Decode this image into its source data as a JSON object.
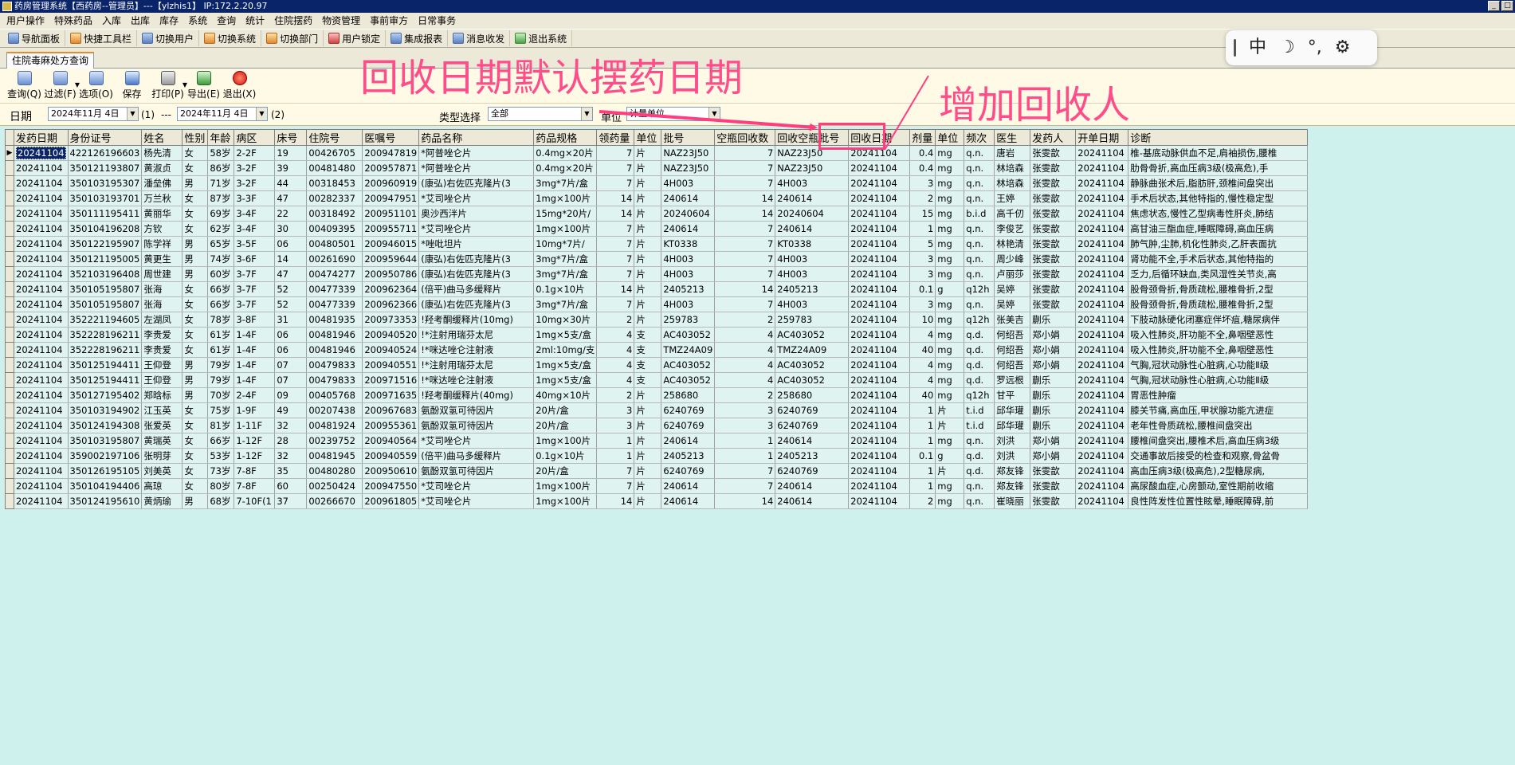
{
  "window": {
    "title": "药房管理系统【西药房--管理员】---【ylzhis1】 IP:172.2.20.97",
    "controls": [
      "_",
      "□"
    ]
  },
  "menus": [
    "用户操作",
    "特殊药品",
    "入库",
    "出库",
    "库存",
    "系统",
    "查询",
    "统计",
    "住院摆药",
    "物资管理",
    "事前审方",
    "日常事务"
  ],
  "quick_toolbar": [
    "导航面板",
    "快捷工具栏",
    "切换用户",
    "切换系统",
    "切换部门",
    "用户锁定",
    "集成报表",
    "消息收发",
    "退出系统"
  ],
  "tab": {
    "label": "住院毒麻处方查询"
  },
  "toolbar": {
    "buttons": [
      "查询(Q)",
      "过滤(F)",
      "选项(O)",
      "保存",
      "打印(P)",
      "导出(E)",
      "退出(X)"
    ]
  },
  "filter": {
    "date_label": "日期",
    "date_from": "2024年11月 4日",
    "date_to": "2024年11月 4日",
    "marker1": "(1)",
    "sep": "---",
    "marker2": "(2)",
    "type_label": "类型选择",
    "type_value": "全部",
    "unit_label": "单位",
    "unit_value": "计量单位"
  },
  "table": {
    "columns": [
      "发药日期",
      "身份证号",
      "姓名",
      "性别",
      "年龄",
      "病区",
      "床号",
      "住院号",
      "医嘱号",
      "药品名称",
      "药品规格",
      "领药量",
      "单位",
      "批号",
      "空瓶回收数",
      "回收空瓶批号",
      "回收日期",
      "剂量",
      "单位",
      "频次",
      "医生",
      "发药人",
      "开单日期",
      "诊断"
    ],
    "rows": [
      [
        "20241104",
        "422126196603",
        "杨先清",
        "女",
        "58岁",
        "2-2F",
        "19",
        "00426705",
        "200947819",
        "*阿普唑仑片",
        "0.4mg×20片",
        "7",
        "片",
        "NAZ23J50",
        "7",
        "NAZ23J50",
        "20241104",
        "0.4",
        "mg",
        "q.n.",
        "唐岩",
        "张雯歆",
        "20241104",
        "椎-基底动脉供血不足,肩袖损伤,腰椎"
      ],
      [
        "20241104",
        "350121193807",
        "黄淑贞",
        "女",
        "86岁",
        "3-2F",
        "39",
        "00481480",
        "200957871",
        "*阿普唑仑片",
        "0.4mg×20片",
        "7",
        "片",
        "NAZ23J50",
        "7",
        "NAZ23J50",
        "20241104",
        "0.4",
        "mg",
        "q.n.",
        "林培森",
        "张雯歆",
        "20241104",
        "肋骨骨折,高血压病3级(极高危),手"
      ],
      [
        "20241104",
        "350103195307",
        "潘垒佛",
        "男",
        "71岁",
        "3-2F",
        "44",
        "00318453",
        "200960919",
        "(康弘)右佐匹克隆片(3",
        "3mg*7片/盒",
        "7",
        "片",
        "4H003",
        "7",
        "4H003",
        "20241104",
        "3",
        "mg",
        "q.n.",
        "林培森",
        "张雯歆",
        "20241104",
        "静脉曲张术后,脂肪肝,颈椎间盘突出"
      ],
      [
        "20241104",
        "350103193701",
        "万兰秋",
        "女",
        "87岁",
        "3-3F",
        "47",
        "00282337",
        "200947951",
        "*艾司唑仑片",
        "1mg×100片",
        "14",
        "片",
        "240614",
        "14",
        "240614",
        "20241104",
        "2",
        "mg",
        "q.n.",
        "王婷",
        "张雯歆",
        "20241104",
        "手术后状态,其他特指的,慢性稳定型"
      ],
      [
        "20241104",
        "350111195411",
        "黄丽华",
        "女",
        "69岁",
        "3-4F",
        "22",
        "00318492",
        "200951101",
        "奥沙西泮片",
        "15mg*20片/",
        "14",
        "片",
        "20240604",
        "14",
        "20240604",
        "20241104",
        "15",
        "mg",
        "b.i.d",
        "高千仞",
        "张雯歆",
        "20241104",
        "焦虑状态,慢性乙型病毒性肝炎,肺结"
      ],
      [
        "20241104",
        "350104196208",
        "方钦",
        "女",
        "62岁",
        "3-4F",
        "30",
        "00409395",
        "200955711",
        "*艾司唑仑片",
        "1mg×100片",
        "7",
        "片",
        "240614",
        "7",
        "240614",
        "20241104",
        "1",
        "mg",
        "q.n.",
        "李俊艺",
        "张雯歆",
        "20241104",
        "高甘油三酯血症,睡眠障碍,高血压病"
      ],
      [
        "20241104",
        "350122195907",
        "陈学祥",
        "男",
        "65岁",
        "3-5F",
        "06",
        "00480501",
        "200946015",
        "*唑吡坦片",
        "10mg*7片/",
        "7",
        "片",
        "KT0338",
        "7",
        "KT0338",
        "20241104",
        "5",
        "mg",
        "q.n.",
        "林艳清",
        "张雯歆",
        "20241104",
        "肺气肿,尘肺,机化性肺炎,乙肝表面抗"
      ],
      [
        "20241104",
        "350121195005",
        "黄更生",
        "男",
        "74岁",
        "3-6F",
        "14",
        "00261690",
        "200959644",
        "(康弘)右佐匹克隆片(3",
        "3mg*7片/盒",
        "7",
        "片",
        "4H003",
        "7",
        "4H003",
        "20241104",
        "3",
        "mg",
        "q.n.",
        "周少峰",
        "张雯歆",
        "20241104",
        "肾功能不全,手术后状态,其他特指的"
      ],
      [
        "20241104",
        "352103196408",
        "周世建",
        "男",
        "60岁",
        "3-7F",
        "47",
        "00474277",
        "200950786",
        "(康弘)右佐匹克隆片(3",
        "3mg*7片/盒",
        "7",
        "片",
        "4H003",
        "7",
        "4H003",
        "20241104",
        "3",
        "mg",
        "q.n.",
        "卢丽莎",
        "张雯歆",
        "20241104",
        "乏力,后循环缺血,类风湿性关节炎,高"
      ],
      [
        "20241104",
        "350105195807",
        "张海",
        "女",
        "66岁",
        "3-7F",
        "52",
        "00477339",
        "200962364",
        "(倍平)曲马多缓释片",
        "0.1g×10片",
        "14",
        "片",
        "2405213",
        "14",
        "2405213",
        "20241104",
        "0.1",
        "g",
        "q12h",
        "吴婷",
        "张雯歆",
        "20241104",
        "股骨颈骨折,骨质疏松,腰椎骨折,2型"
      ],
      [
        "20241104",
        "350105195807",
        "张海",
        "女",
        "66岁",
        "3-7F",
        "52",
        "00477339",
        "200962366",
        "(康弘)右佐匹克隆片(3",
        "3mg*7片/盒",
        "7",
        "片",
        "4H003",
        "7",
        "4H003",
        "20241104",
        "3",
        "mg",
        "q.n.",
        "吴婷",
        "张雯歆",
        "20241104",
        "股骨颈骨折,骨质疏松,腰椎骨折,2型"
      ],
      [
        "20241104",
        "352221194605",
        "左湖凤",
        "女",
        "78岁",
        "3-8F",
        "31",
        "00481935",
        "200973353",
        "!羟考酮缓释片(10mg)",
        "10mg×30片",
        "2",
        "片",
        "259783",
        "2",
        "259783",
        "20241104",
        "10",
        "mg",
        "q12h",
        "张美吉",
        "蒯乐",
        "20241104",
        "下肢动脉硬化闭塞症伴坏疽,糖尿病伴"
      ],
      [
        "20241104",
        "352228196211",
        "李贵爱",
        "女",
        "61岁",
        "1-4F",
        "06",
        "00481946",
        "200940520",
        "!*注射用瑞芬太尼",
        "1mg×5支/盒",
        "4",
        "支",
        "AC403052",
        "4",
        "AC403052",
        "20241104",
        "4",
        "mg",
        "q.d.",
        "何绍吾",
        "郑小娟",
        "20241104",
        "吸入性肺炎,肝功能不全,鼻咽壁恶性"
      ],
      [
        "20241104",
        "352228196211",
        "李贵爱",
        "女",
        "61岁",
        "1-4F",
        "06",
        "00481946",
        "200940524",
        "!*咪达唑仑注射液",
        "2ml:10mg/支",
        "4",
        "支",
        "TMZ24A09",
        "4",
        "TMZ24A09",
        "20241104",
        "40",
        "mg",
        "q.d.",
        "何绍吾",
        "郑小娟",
        "20241104",
        "吸入性肺炎,肝功能不全,鼻咽壁恶性"
      ],
      [
        "20241104",
        "350125194411",
        "王仰登",
        "男",
        "79岁",
        "1-4F",
        "07",
        "00479833",
        "200940551",
        "!*注射用瑞芬太尼",
        "1mg×5支/盒",
        "4",
        "支",
        "AC403052",
        "4",
        "AC403052",
        "20241104",
        "4",
        "mg",
        "q.d.",
        "何绍吾",
        "郑小娟",
        "20241104",
        "气胸,冠状动脉性心脏病,心功能Ⅱ级"
      ],
      [
        "20241104",
        "350125194411",
        "王仰登",
        "男",
        "79岁",
        "1-4F",
        "07",
        "00479833",
        "200971516",
        "!*咪达唑仑注射液",
        "1mg×5支/盒",
        "4",
        "支",
        "AC403052",
        "4",
        "AC403052",
        "20241104",
        "4",
        "mg",
        "q.d.",
        "罗远根",
        "蒯乐",
        "20241104",
        "气胸,冠状动脉性心脏病,心功能Ⅱ级"
      ],
      [
        "20241104",
        "350127195402",
        "郑晗标",
        "男",
        "70岁",
        "2-4F",
        "09",
        "00405768",
        "200971635",
        "!羟考酮缓释片(40mg)",
        "40mg×10片",
        "2",
        "片",
        "258680",
        "2",
        "258680",
        "20241104",
        "40",
        "mg",
        "q12h",
        "甘平",
        "蒯乐",
        "20241104",
        "胃恶性肿瘤"
      ],
      [
        "20241104",
        "350103194902",
        "江玉英",
        "女",
        "75岁",
        "1-9F",
        "49",
        "00207438",
        "200967683",
        "氨酚双氢可待因片",
        "20片/盒",
        "3",
        "片",
        "6240769",
        "3",
        "6240769",
        "20241104",
        "1",
        "片",
        "t.i.d",
        "邱华瓘",
        "蒯乐",
        "20241104",
        "膝关节痛,高血压,甲状腺功能亢进症"
      ],
      [
        "20241104",
        "350124194308",
        "张爱英",
        "女",
        "81岁",
        "1-11F",
        "32",
        "00481924",
        "200955361",
        "氨酚双氢可待因片",
        "20片/盒",
        "3",
        "片",
        "6240769",
        "3",
        "6240769",
        "20241104",
        "1",
        "片",
        "t.i.d",
        "邱华瓘",
        "蒯乐",
        "20241104",
        "老年性骨质疏松,腰椎间盘突出"
      ],
      [
        "20241104",
        "350103195807",
        "黄瑞英",
        "女",
        "66岁",
        "1-12F",
        "28",
        "00239752",
        "200940564",
        "*艾司唑仑片",
        "1mg×100片",
        "1",
        "片",
        "240614",
        "1",
        "240614",
        "20241104",
        "1",
        "mg",
        "q.n.",
        "刘洪",
        "郑小娟",
        "20241104",
        "腰椎间盘突出,腰椎术后,高血压病3级"
      ],
      [
        "20241104",
        "359002197106",
        "张明芽",
        "女",
        "53岁",
        "1-12F",
        "32",
        "00481945",
        "200940559",
        "(倍平)曲马多缓释片",
        "0.1g×10片",
        "1",
        "片",
        "2405213",
        "1",
        "2405213",
        "20241104",
        "0.1",
        "g",
        "q.d.",
        "刘洪",
        "郑小娟",
        "20241104",
        "交通事故后接受的检查和观察,骨盆骨"
      ],
      [
        "20241104",
        "350126195105",
        "刘美英",
        "女",
        "73岁",
        "7-8F",
        "35",
        "00480280",
        "200950610",
        "氨酚双氢可待因片",
        "20片/盒",
        "7",
        "片",
        "6240769",
        "7",
        "6240769",
        "20241104",
        "1",
        "片",
        "q.d.",
        "郑友锋",
        "张雯歆",
        "20241104",
        "高血压病3级(极高危),2型糖尿病,"
      ],
      [
        "20241104",
        "350104194406",
        "高琼",
        "女",
        "80岁",
        "7-8F",
        "60",
        "00250424",
        "200947550",
        "*艾司唑仑片",
        "1mg×100片",
        "7",
        "片",
        "240614",
        "7",
        "240614",
        "20241104",
        "1",
        "mg",
        "q.n.",
        "郑友锋",
        "张雯歆",
        "20241104",
        "高尿酸血症,心房颤动,室性期前收缩"
      ],
      [
        "20241104",
        "350124195610",
        "黄炳瑜",
        "男",
        "68岁",
        "7-10F(1",
        "37",
        "00266670",
        "200961805",
        "*艾司唑仑片",
        "1mg×100片",
        "14",
        "片",
        "240614",
        "14",
        "240614",
        "20241104",
        "2",
        "mg",
        "q.n.",
        "崔晓丽",
        "张雯歆",
        "20241104",
        "良性阵发性位置性眩晕,睡眠障碍,前"
      ]
    ]
  },
  "annotations": {
    "title": "回收日期默认摆药日期",
    "note": "增加回收人",
    "color": "#ff3d7f"
  },
  "ime": {
    "mode": "中",
    "moon": "☽",
    "punct": "°,",
    "settings": "⚙"
  }
}
